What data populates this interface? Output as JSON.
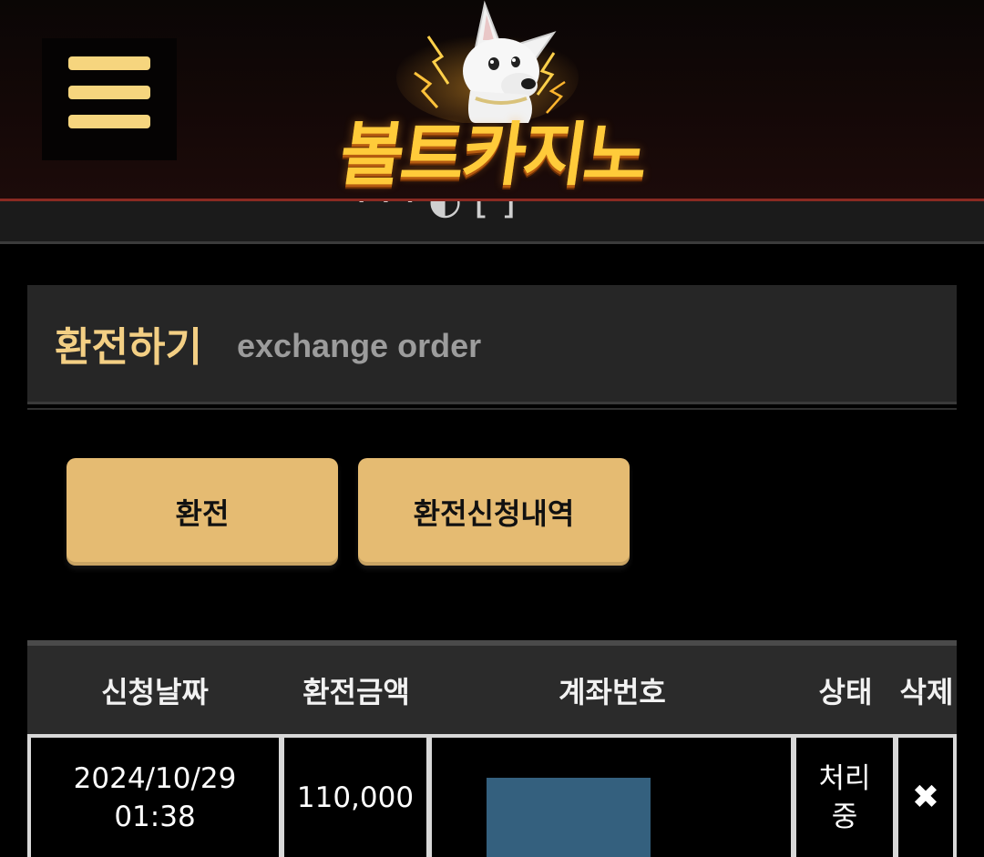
{
  "header": {
    "logo_text": "볼트카지노",
    "menu_icon": "hamburger-icon",
    "logo_icon": "dog-mascot-icon"
  },
  "subbar": {
    "partial_text": "·   ·   ·   ◐ [  ]"
  },
  "section": {
    "title": "환전하기",
    "subtitle": "exchange order"
  },
  "buttons": {
    "exchange_label": "환전",
    "history_label": "환전신청내역"
  },
  "table": {
    "headers": {
      "date": "신청날짜",
      "amount": "환전금액",
      "account": "계좌번호",
      "status": "상태",
      "delete": "삭제"
    },
    "rows": [
      {
        "date": "2024/10/29",
        "time": "01:38",
        "amount": "110,000",
        "status_line1": "처리",
        "status_line2": "중",
        "delete_icon": "✖"
      }
    ]
  },
  "colors": {
    "accent_gold": "#e5bb72",
    "title_gold": "#f3cf84",
    "menu_gold": "#f6d57e",
    "header_red_line": "#8a2a22",
    "redaction_blue": "#34607e"
  }
}
